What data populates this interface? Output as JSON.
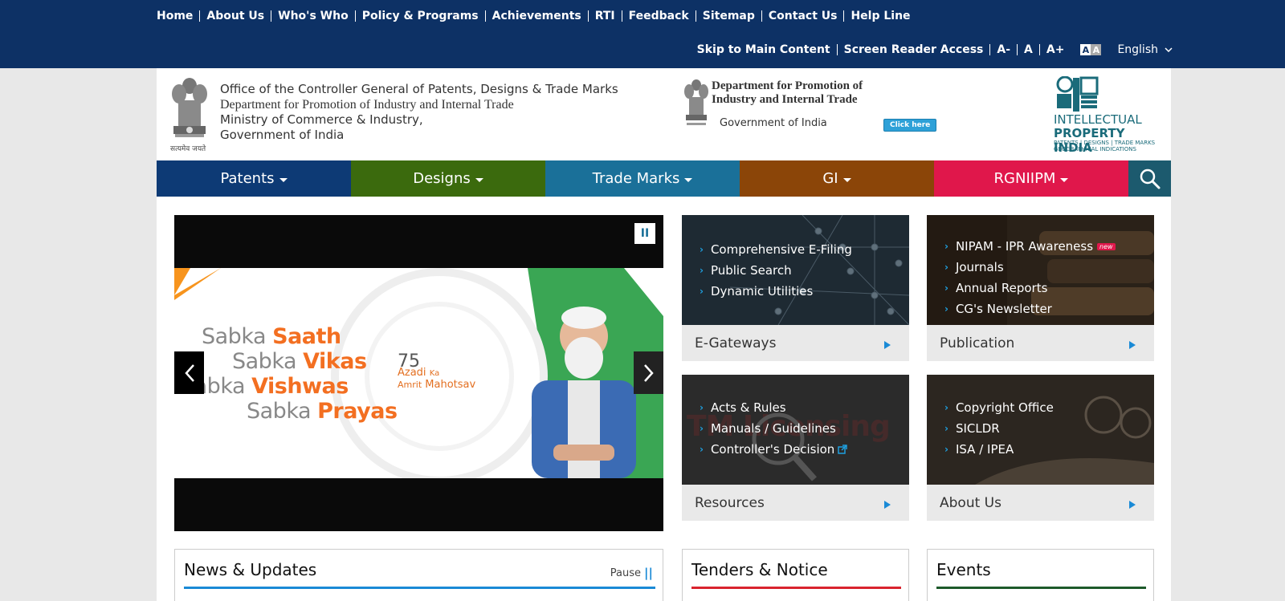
{
  "top_nav": {
    "items": [
      "Home",
      "About Us",
      "Who's Who",
      "Policy & Programs",
      "Achievements",
      "RTI",
      "Feedback",
      "Sitemap",
      "Contact Us",
      "Help Line"
    ]
  },
  "utility": {
    "skip": "Skip to Main Content",
    "screen_reader": "Screen Reader Access",
    "font_minus": "A-",
    "font_normal": "A",
    "font_plus": "A+",
    "contrast_a1": "A",
    "contrast_a2": "A",
    "language": "English"
  },
  "header": {
    "office_line1": "Office of the Controller General of Patents, Designs & Trade Marks",
    "office_line2": "Department for Promotion of Industry and Internal Trade",
    "office_line3": "Ministry of Commerce & Industry,",
    "office_line4": "Government of India",
    "emblem_caption": "सत्यमेव जयते",
    "dept_title_1": "Department for Promotion of",
    "dept_title_2": "Industry and Internal Trade",
    "dept_sub": "Government of India",
    "click_here": "Click here",
    "ipi_line1": "INTELLECTUAL",
    "ipi_line2": "PROPERTY INDIA",
    "ipi_line3": "PATENTS | DESIGNS | TRADE MARKS GEOGRAPHICAL INDICATIONS"
  },
  "category_nav": {
    "patents": "Patents",
    "designs": "Designs",
    "trade_marks": "Trade Marks",
    "gi": "GI",
    "rgniipm": "RGNIIPM"
  },
  "carousel": {
    "pause": "II",
    "prev": "‹",
    "next": "›",
    "slogan": [
      {
        "grey": "Sabka ",
        "orange": "Saath"
      },
      {
        "grey": "Sabka ",
        "orange": "Vikas"
      },
      {
        "grey": "Sabka ",
        "orange": "Vishwas"
      },
      {
        "grey": "Sabka ",
        "orange": "Prayas"
      }
    ],
    "azadi_1": "Azadi",
    "azadi_2": "Ka",
    "azadi_3": "Amrit",
    "azadi_4": "Mahotsav"
  },
  "tiles": {
    "egateways": {
      "label": "E-Gateways",
      "links": [
        "Comprehensive E-Filing",
        "Public Search",
        "Dynamic Utilities"
      ]
    },
    "publication": {
      "label": "Publication",
      "links": [
        "NIPAM - IPR Awareness",
        "Journals",
        "Annual Reports",
        "CG's Newsletter"
      ],
      "new_badge": "new"
    },
    "resources": {
      "label": "Resources",
      "links": [
        "Acts & Rules",
        "Manuals / Guidelines",
        "Controller's Decision"
      ],
      "bg_text": "TM Licensing"
    },
    "about": {
      "label": "About Us",
      "links": [
        "Copyright Office",
        "SICLDR",
        "ISA / IPEA"
      ]
    }
  },
  "boxes": {
    "news": {
      "title": "News & Updates",
      "pause": "Pause",
      "pause_icon": "||"
    },
    "tenders": {
      "title": "Tenders & Notice"
    },
    "events": {
      "title": "Events"
    }
  },
  "colors": {
    "topbar": "#0d3165",
    "patents": "#0d3a75",
    "designs": "#3b6a0d",
    "trade_marks": "#1a7099",
    "gi": "#8b4508",
    "rgniipm": "#e0174b",
    "search": "#1c5a6e",
    "news_line": "#1a8ad6",
    "tenders_line": "#d9232e",
    "events_line": "#1d5a2a"
  }
}
